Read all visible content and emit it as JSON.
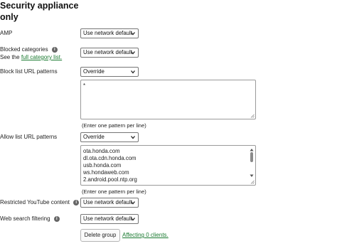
{
  "heading": {
    "line1": "Security appliance",
    "line2": "only"
  },
  "amp": {
    "label": "AMP",
    "select_value": "Use network default"
  },
  "blocked_categories": {
    "label": "Blocked categories",
    "see_prefix": "See the",
    "link_text": "full category list.",
    "select_value": "Use network default",
    "info_glyph": "i"
  },
  "block_list": {
    "label": "Block list URL patterns",
    "select_value": "Override",
    "text": "*",
    "hint": "(Enter one pattern per line)"
  },
  "allow_list": {
    "label": "Allow list URL patterns",
    "select_value": "Override",
    "lines": [
      "ota.honda.com",
      "dl.ota.cdn.honda.com",
      "usb.honda.com",
      "ws.hondaweb.com",
      "2.android.pool.ntp.org"
    ],
    "hint": "(Enter one pattern per line)"
  },
  "restricted_youtube": {
    "label": "Restricted YouTube content",
    "select_value": "Use network default",
    "info_glyph": "i"
  },
  "web_search": {
    "label": "Web search filtering",
    "select_value": "Use network default",
    "info_glyph": "i"
  },
  "footer": {
    "delete_label": "Delete group",
    "affecting_text": "Affecting 0 clients."
  },
  "colors": {
    "link": "#1a7a30"
  }
}
